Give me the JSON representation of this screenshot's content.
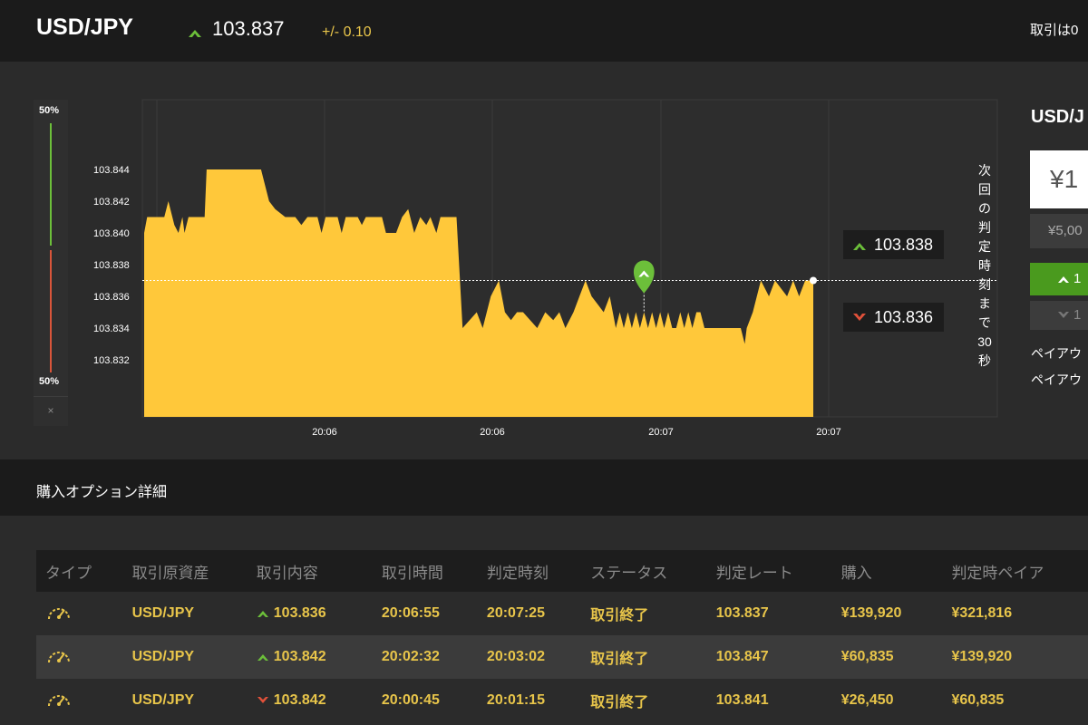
{
  "header": {
    "pair": "USD/JPY",
    "price": "103.837",
    "change": "+/- 0.10",
    "right_text": "取引は0"
  },
  "gauge": {
    "top_label": "50%",
    "bottom_label": "50%",
    "close_label": "×"
  },
  "chart_data": {
    "type": "area",
    "y_ticks": [
      "103.844",
      "103.842",
      "103.840",
      "103.838",
      "103.836",
      "103.834",
      "103.832"
    ],
    "x_ticks": [
      "20:06",
      "20:06",
      "20:07",
      "20:07"
    ],
    "ylim": [
      103.8295,
      103.8455
    ],
    "points": [
      [
        0,
        103.84
      ],
      [
        1.5,
        103.841
      ],
      [
        10,
        103.841
      ],
      [
        12,
        103.842
      ],
      [
        15,
        103.8405
      ],
      [
        17,
        103.84
      ],
      [
        19,
        103.841
      ],
      [
        20,
        103.84
      ],
      [
        22,
        103.841
      ],
      [
        30,
        103.841
      ],
      [
        31,
        103.844
      ],
      [
        58,
        103.844
      ],
      [
        62,
        103.842
      ],
      [
        65,
        103.8415
      ],
      [
        70,
        103.841
      ],
      [
        75,
        103.841
      ],
      [
        78,
        103.8405
      ],
      [
        81,
        103.841
      ],
      [
        86,
        103.841
      ],
      [
        88,
        103.84
      ],
      [
        90,
        103.841
      ],
      [
        96,
        103.841
      ],
      [
        98,
        103.84
      ],
      [
        100,
        103.841
      ],
      [
        106,
        103.841
      ],
      [
        108,
        103.8405
      ],
      [
        110,
        103.841
      ],
      [
        118,
        103.841
      ],
      [
        120,
        103.84
      ],
      [
        125,
        103.84
      ],
      [
        128,
        103.841
      ],
      [
        131,
        103.8415
      ],
      [
        134,
        103.84
      ],
      [
        137,
        103.841
      ],
      [
        140,
        103.8405
      ],
      [
        142,
        103.841
      ],
      [
        145,
        103.84
      ],
      [
        147,
        103.841
      ],
      [
        155,
        103.841
      ],
      [
        158,
        103.834
      ],
      [
        165,
        103.835
      ],
      [
        168,
        103.834
      ],
      [
        172,
        103.836
      ],
      [
        176,
        103.837
      ],
      [
        179,
        103.835
      ],
      [
        182,
        103.8345
      ],
      [
        185,
        103.835
      ],
      [
        188,
        103.835
      ],
      [
        195,
        103.834
      ],
      [
        199,
        103.835
      ],
      [
        203,
        103.8345
      ],
      [
        206,
        103.835
      ],
      [
        209,
        103.834
      ],
      [
        213,
        103.835
      ],
      [
        216,
        103.836
      ],
      [
        219,
        103.837
      ],
      [
        222,
        103.836
      ],
      [
        225,
        103.8355
      ],
      [
        228,
        103.835
      ],
      [
        231,
        103.836
      ],
      [
        234,
        103.834
      ],
      [
        236,
        103.835
      ],
      [
        238,
        103.834
      ],
      [
        240,
        103.835
      ],
      [
        242,
        103.834
      ],
      [
        244,
        103.835
      ],
      [
        246,
        103.834
      ],
      [
        248,
        103.835
      ],
      [
        250,
        103.834
      ],
      [
        252,
        103.835
      ],
      [
        254,
        103.834
      ],
      [
        256,
        103.835
      ],
      [
        258,
        103.834
      ],
      [
        260,
        103.835
      ],
      [
        262,
        103.834
      ],
      [
        264,
        103.834
      ],
      [
        266,
        103.835
      ],
      [
        268,
        103.834
      ],
      [
        270,
        103.835
      ],
      [
        272,
        103.834
      ],
      [
        274,
        103.835
      ],
      [
        276,
        103.835
      ],
      [
        278,
        103.834
      ],
      [
        296,
        103.834
      ],
      [
        298,
        103.833
      ],
      [
        299,
        103.834
      ],
      [
        302,
        103.835
      ],
      [
        306,
        103.837
      ],
      [
        310,
        103.836
      ],
      [
        313,
        103.837
      ],
      [
        316,
        103.8365
      ],
      [
        319,
        103.836
      ],
      [
        322,
        103.837
      ],
      [
        325,
        103.836
      ],
      [
        328,
        103.837
      ],
      [
        332,
        103.837
      ]
    ],
    "current_value": 103.837,
    "marker_value": 103.837,
    "marker_x": 248
  },
  "price_tags": {
    "up": "103.838",
    "down": "103.836"
  },
  "next_judge": [
    "次",
    "回",
    "の",
    "判",
    "定",
    "時",
    "刻",
    "ま",
    "で",
    "30",
    "秒"
  ],
  "right_panel": {
    "title": "USD/J",
    "amount": "¥1",
    "preset": "¥5,00",
    "high_label": "1",
    "low_label": "1",
    "payout1": "ペイアウ",
    "payout2": "ペイアウ"
  },
  "section": {
    "title": "購入オプション詳細"
  },
  "table": {
    "headers": [
      "タイプ",
      "取引原資産",
      "取引内容",
      "取引時間",
      "判定時刻",
      "ステータス",
      "判定レート",
      "購入",
      "判定時ペイア"
    ],
    "rows": [
      {
        "asset": "USD/JPY",
        "direction": "up",
        "content": "103.836",
        "time": "20:06:55",
        "judge_time": "20:07:25",
        "status": "取引終了",
        "rate": "103.837",
        "purchase": "¥139,920",
        "payout": "¥321,816"
      },
      {
        "asset": "USD/JPY",
        "direction": "up",
        "content": "103.842",
        "time": "20:02:32",
        "judge_time": "20:03:02",
        "status": "取引終了",
        "rate": "103.847",
        "purchase": "¥60,835",
        "payout": "¥139,920"
      },
      {
        "asset": "USD/JPY",
        "direction": "down",
        "content": "103.842",
        "time": "20:00:45",
        "judge_time": "20:01:15",
        "status": "取引終了",
        "rate": "103.841",
        "purchase": "¥26,450",
        "payout": "¥60,835"
      }
    ]
  },
  "colors": {
    "up": "#6cbf3a",
    "down": "#e0513a",
    "area": "#ffc83a",
    "accent": "#e8c54a"
  }
}
